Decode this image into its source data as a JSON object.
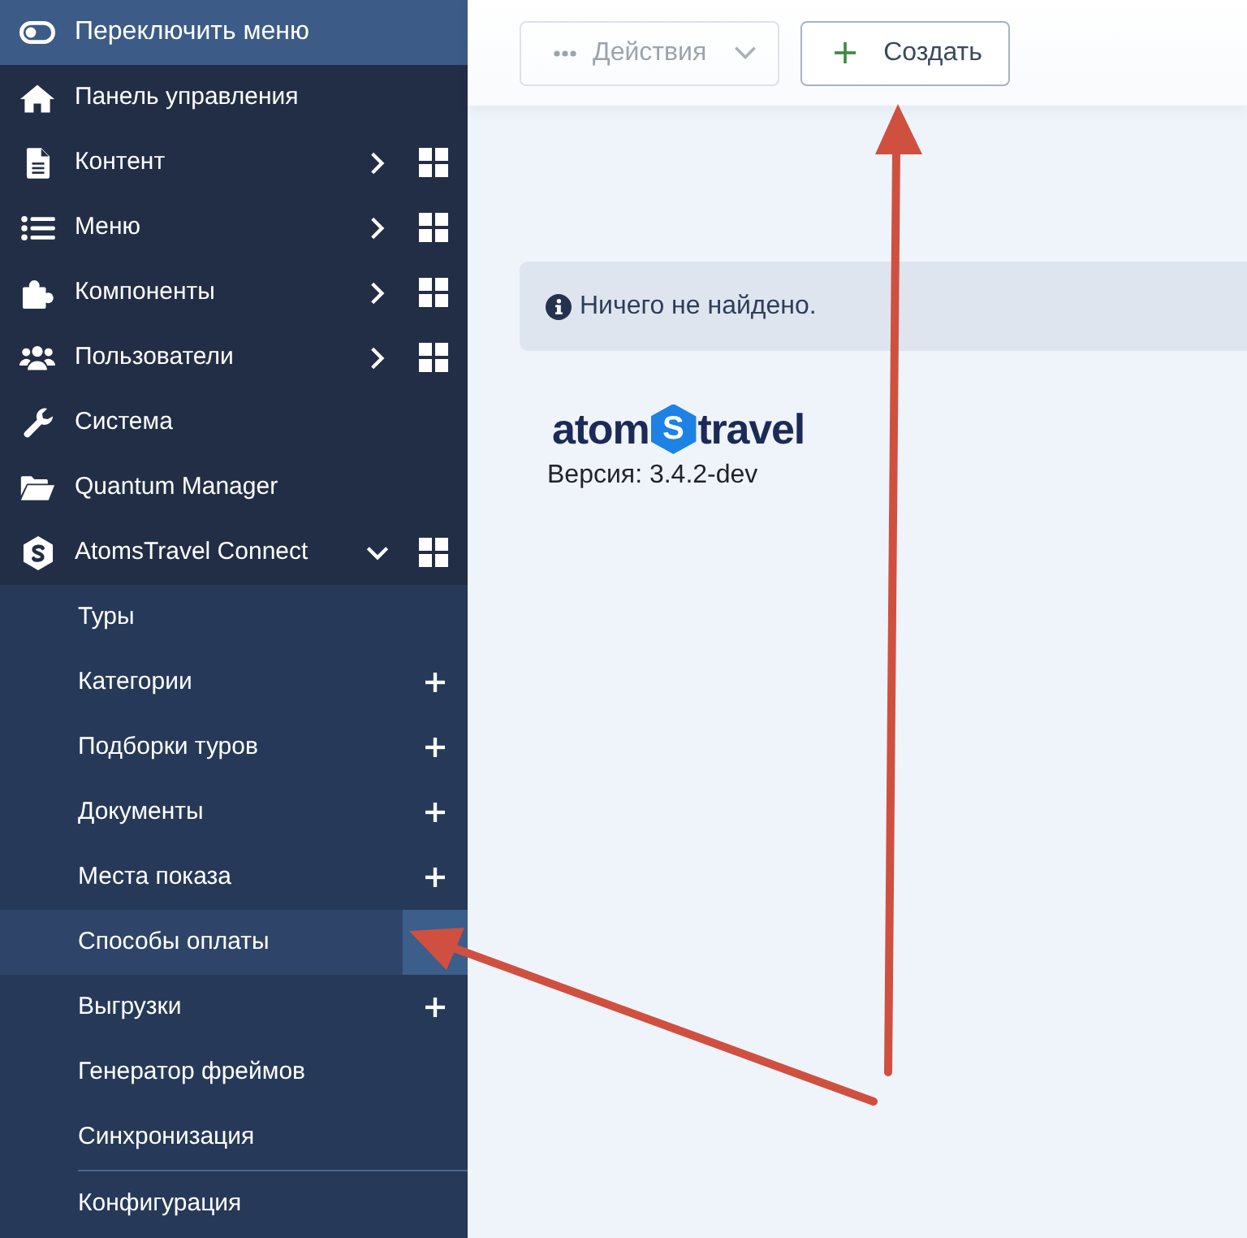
{
  "sidebar": {
    "toggle": {
      "label": "Переключить меню"
    },
    "items": [
      {
        "label": "Панель управления"
      },
      {
        "label": "Контент",
        "expanded": false
      },
      {
        "label": "Меню",
        "expanded": false
      },
      {
        "label": "Компоненты",
        "expanded": false
      },
      {
        "label": "Пользователи",
        "expanded": false
      },
      {
        "label": "Система"
      },
      {
        "label": "Quantum Manager"
      },
      {
        "label": "AtomsTravel Connect",
        "expanded": true,
        "children": [
          {
            "label": "Туры",
            "selected": false,
            "add_button": false,
            "separator": false
          },
          {
            "label": "Категории",
            "selected": false,
            "add_button": true,
            "separator": false
          },
          {
            "label": "Подборки туров",
            "selected": false,
            "add_button": true,
            "separator": false
          },
          {
            "label": "Документы",
            "selected": false,
            "add_button": true,
            "separator": false
          },
          {
            "label": "Места показа",
            "selected": false,
            "add_button": true,
            "separator": false
          },
          {
            "label": "Способы оплаты",
            "selected": true,
            "add_button": false,
            "separator": false
          },
          {
            "label": "Выгрузки",
            "selected": false,
            "add_button": true,
            "separator": false
          },
          {
            "label": "Генератор фреймов",
            "selected": false,
            "add_button": false,
            "separator": false
          },
          {
            "label": "Синхронизация",
            "selected": false,
            "add_button": false,
            "separator": false
          },
          {
            "label": "Конфигурация",
            "selected": false,
            "add_button": false,
            "separator": true
          }
        ]
      }
    ]
  },
  "toolbar": {
    "buttons": [
      {
        "kind": "actions",
        "label": "Действия",
        "disabled": true
      },
      {
        "kind": "create",
        "label": "Создать",
        "disabled": false
      }
    ]
  },
  "alert": {
    "text": "Ничего не найдено."
  },
  "logo": {
    "left": "atom",
    "mark": "S",
    "right": "travel"
  },
  "version": "Версия: 3.4.2-dev"
}
